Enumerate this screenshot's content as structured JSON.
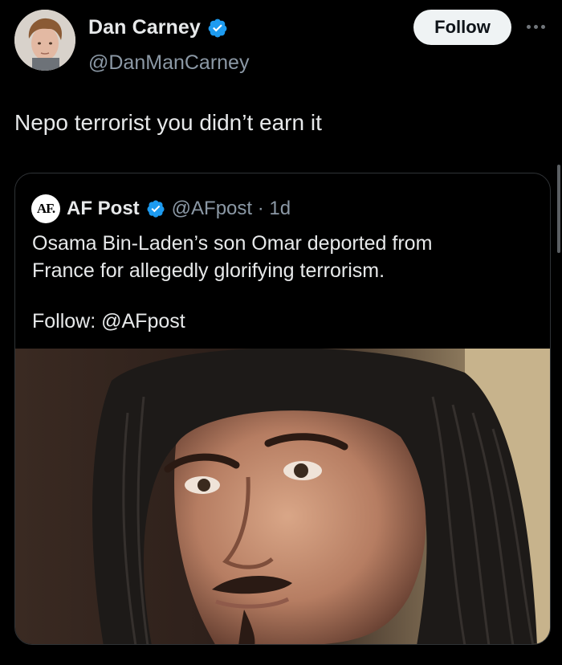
{
  "author": {
    "display_name": "Dan Carney",
    "handle": "@DanManCarney",
    "verified": true
  },
  "follow_button": {
    "label": "Follow"
  },
  "more_icon": "more-horizontal-icon",
  "tweet": {
    "text": "Nepo terrorist you didn’t earn it"
  },
  "quoted_post": {
    "logo_text": "AF.",
    "display_name": "AF Post",
    "handle_time": "@AFpost · 1d",
    "verified": true,
    "body_lines": [
      "Osama Bin-Laden’s son Omar deported from",
      "France for allegedly glorifying terrorism."
    ],
    "follow_line": "Follow: @AFpost"
  },
  "colors": {
    "background": "#000000",
    "primary_text": "#e7e9ea",
    "secondary_text": "#8b98a5",
    "verified_blue": "#1d9bf0",
    "border": "#2f3336",
    "button_bg": "#eff3f4"
  }
}
